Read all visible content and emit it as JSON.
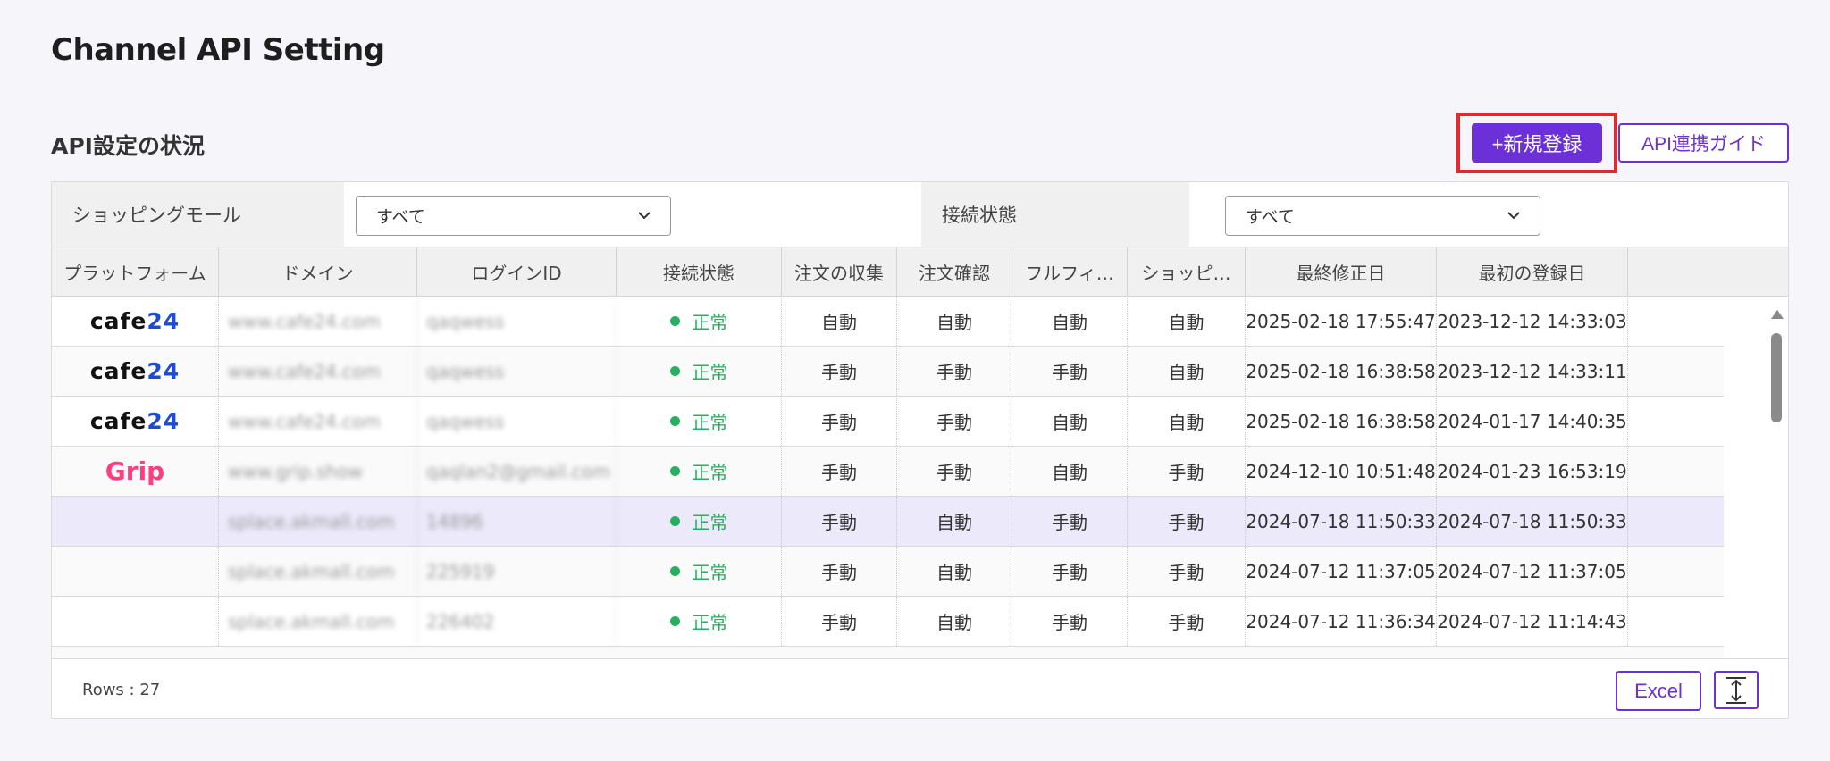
{
  "page": {
    "title": "Channel API Setting"
  },
  "section": {
    "title": "API設定の状況",
    "new_button": "+新規登録",
    "guide_button": "API連携ガイド"
  },
  "filters": {
    "mall_label": "ショッピングモール",
    "mall_value": "すべて",
    "status_label": "接続状態",
    "status_value": "すべて"
  },
  "table": {
    "headers": [
      "プラットフォーム",
      "ドメイン",
      "ログインID",
      "接続状態",
      "注文の収集",
      "注文確認",
      "フルフィ…",
      "ショッピ…",
      "最終修正日",
      "最初の登録日"
    ],
    "rows": [
      {
        "platform": "cafe24",
        "domain": "www.cafe24.com",
        "login": "qaqwess",
        "status": "正常",
        "c1": "自動",
        "c2": "自動",
        "c3": "自動",
        "c4": "自動",
        "modified": "2025-02-18 17:55:47",
        "registered": "2023-12-12 14:33:03"
      },
      {
        "platform": "cafe24",
        "domain": "www.cafe24.com",
        "login": "qaqwess",
        "status": "正常",
        "c1": "手動",
        "c2": "手動",
        "c3": "手動",
        "c4": "自動",
        "modified": "2025-02-18 16:38:58",
        "registered": "2023-12-12 14:33:11"
      },
      {
        "platform": "cafe24",
        "domain": "www.cafe24.com",
        "login": "qaqwess",
        "status": "正常",
        "c1": "手動",
        "c2": "手動",
        "c3": "自動",
        "c4": "自動",
        "modified": "2025-02-18 16:38:58",
        "registered": "2024-01-17 14:40:35"
      },
      {
        "platform": "Grip",
        "domain": "www.grip.show",
        "login": "qaqlan2@gmail.com",
        "status": "正常",
        "c1": "手動",
        "c2": "手動",
        "c3": "自動",
        "c4": "手動",
        "modified": "2024-12-10 10:51:48",
        "registered": "2024-01-23 16:53:19"
      },
      {
        "platform": "",
        "domain": "splace.akmall.com",
        "login": "14896",
        "status": "正常",
        "c1": "手動",
        "c2": "自動",
        "c3": "手動",
        "c4": "手動",
        "modified": "2024-07-18 11:50:33",
        "registered": "2024-07-18 11:50:33"
      },
      {
        "platform": "",
        "domain": "splace.akmall.com",
        "login": "225919",
        "status": "正常",
        "c1": "手動",
        "c2": "自動",
        "c3": "手動",
        "c4": "手動",
        "modified": "2024-07-12 11:37:05",
        "registered": "2024-07-12 11:37:05"
      },
      {
        "platform": "",
        "domain": "splace.akmall.com",
        "login": "226402",
        "status": "正常",
        "c1": "手動",
        "c2": "自動",
        "c3": "手動",
        "c4": "手動",
        "modified": "2024-07-12 11:36:34",
        "registered": "2024-07-12 11:14:43"
      }
    ]
  },
  "footer": {
    "rows_label": "Rows : 27",
    "excel_button": "Excel"
  },
  "colors": {
    "accent": "#6c30d8",
    "highlight": "#e6282d",
    "ok": "#27ae60"
  }
}
